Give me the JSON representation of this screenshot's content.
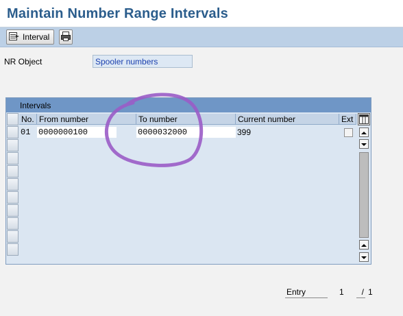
{
  "app": {
    "title": "Maintain Number Range Intervals"
  },
  "toolbar": {
    "interval_label": "Interval"
  },
  "object": {
    "label": "NR Object",
    "value": "Spooler numbers"
  },
  "intervals": {
    "title": "Intervals",
    "columns": [
      "No.",
      "From number",
      "To number",
      "Current number",
      "Ext"
    ],
    "rows": [
      {
        "no": "01",
        "from": "0000000100",
        "to": "0000032000",
        "current": "399",
        "ext": false
      }
    ]
  },
  "footer": {
    "entry_label": "Entry",
    "entry_current": "1",
    "entry_sep": "/",
    "entry_total": "1"
  },
  "colors": {
    "accent": "#2b5d8c",
    "toolbar": "#bcd0e6",
    "table_header": "#6f96c6",
    "annotation": "#9a5cc6"
  }
}
